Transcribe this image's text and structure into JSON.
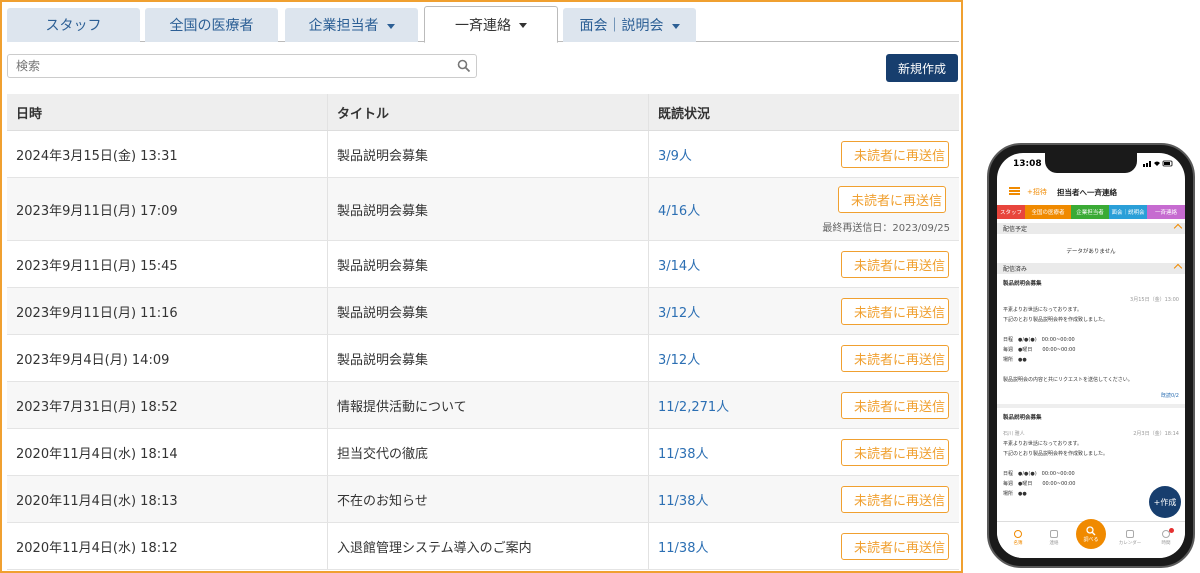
{
  "tabs": [
    {
      "label": "スタッフ",
      "caret": false
    },
    {
      "label": "全国の医療者",
      "caret": false
    },
    {
      "label": "企業担当者",
      "caret": true
    },
    {
      "label": "一斉連絡",
      "caret": true,
      "active": true
    },
    {
      "label": "面会｜説明会",
      "caret": true
    }
  ],
  "search": {
    "placeholder": "検索"
  },
  "new_button": "新規作成",
  "table": {
    "headers": [
      "日時",
      "タイトル",
      "既読状況"
    ],
    "resend_label": "未読者に再送信",
    "rows": [
      {
        "datetime": "2024年3月15日(金) 13:31",
        "title": "製品説明会募集",
        "read": "3/9人"
      },
      {
        "datetime": "2023年9月11日(月) 17:09",
        "title": "製品説明会募集",
        "read": "4/16人",
        "note": "最終再送信日：2023/09/25"
      },
      {
        "datetime": "2023年9月11日(月) 15:45",
        "title": "製品説明会募集",
        "read": "3/14人"
      },
      {
        "datetime": "2023年9月11日(月) 11:16",
        "title": "製品説明会募集",
        "read": "3/12人"
      },
      {
        "datetime": "2023年9月4日(月) 14:09",
        "title": "製品説明会募集",
        "read": "3/12人"
      },
      {
        "datetime": "2023年7月31日(月) 18:52",
        "title": "情報提供活動について",
        "read": "11/2,271人"
      },
      {
        "datetime": "2020年11月4日(水) 18:14",
        "title": "担当交代の徹底",
        "read": "11/38人"
      },
      {
        "datetime": "2020年11月4日(水) 18:13",
        "title": "不在のお知らせ",
        "read": "11/38人"
      },
      {
        "datetime": "2020年11月4日(水) 18:12",
        "title": "入退館管理システム導入のご案内",
        "read": "11/38人"
      }
    ]
  },
  "phone": {
    "time": "13:08",
    "invite": "+招待",
    "title": "担当者へ一斉連絡",
    "tabs": [
      {
        "label": "スタッフ",
        "color": "#e8453c"
      },
      {
        "label": "全国の医療者",
        "color": "#f08a00"
      },
      {
        "label": "企業担当者",
        "color": "#3aaa35"
      },
      {
        "label": "面会｜説明会",
        "color": "#2a9fd8"
      },
      {
        "label": "一斉連絡",
        "color": "#c66bd0"
      }
    ],
    "section_scheduled": "配信予定",
    "no_data": "データがありません",
    "section_sent": "配信済み",
    "msg1": {
      "title": "製品説明会募集",
      "date": "3月15日（金）13:00",
      "line1": "平素よりお世話になっております。",
      "line2": "下記のとおり製品説明会枠を作成致しました。",
      "d1": "日程　●/●(●)　00:00~00:00",
      "d2": "毎週　●曜日　　00:00~00:00",
      "d3": "場所　●●",
      "req": "製品説明会の内容と共にリクエストを送信してください。",
      "read": "既読0/2"
    },
    "msg2": {
      "title": "製品説明会募集",
      "sender": "石川 雅人",
      "date": "2月3日（金）18:14",
      "line1": "平素よりお世話になっております。",
      "line2": "下記のとおり製品説明会枠を作成致しました。",
      "d1": "日程　●/●(●)　00:00~00:00",
      "d2": "毎週　●曜日　　00:00~00:00",
      "d3": "場所　●●"
    },
    "fab": "+作成",
    "nav": [
      "名簿",
      "連絡",
      "調べる",
      "カレンダー",
      "時間"
    ]
  }
}
